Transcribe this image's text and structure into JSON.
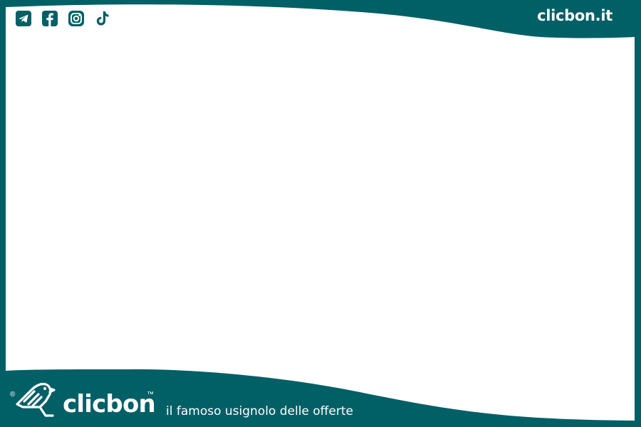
{
  "colors": {
    "frame": "#015f66",
    "content": "#ffffff",
    "icon_bg": "#015f66",
    "icon_fg": "#ffffff"
  },
  "header": {
    "social_icons": [
      "telegram-icon",
      "facebook-icon",
      "instagram-icon",
      "tiktok-icon"
    ],
    "site_url": "clicbon.it"
  },
  "footer": {
    "registered_mark": "®",
    "brand_name": "clicbon",
    "trademark_mark": "™",
    "tagline": "il famoso usignolo delle offerte"
  }
}
